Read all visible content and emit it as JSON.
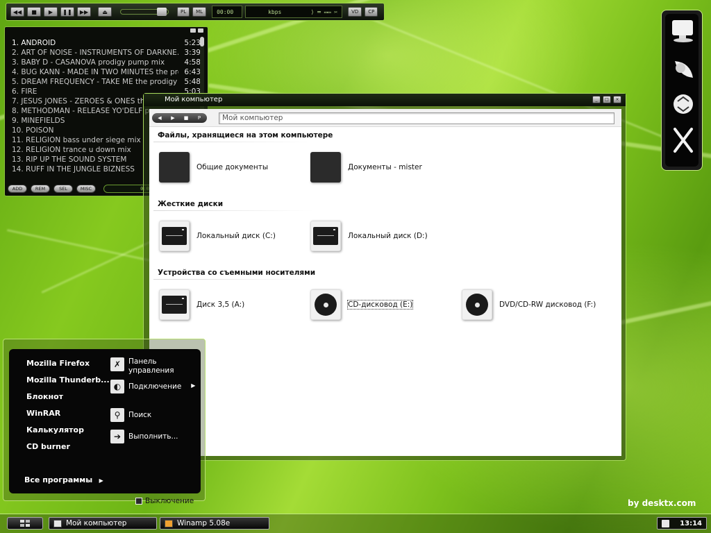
{
  "player": {
    "buttons": [
      "◀◀",
      "■",
      "▶",
      "❚❚",
      "▶▶",
      "⏏"
    ],
    "pl_label": "PL",
    "ml_label": "ML",
    "time": "00:00",
    "kbps": "kbps",
    "vd_label": "VD",
    "cp_label": "CP"
  },
  "playlist": {
    "tracks": [
      {
        "title": "1. ANDROID",
        "duration": "5:23"
      },
      {
        "title": "2. ART OF NOISE - INSTRUMENTS OF DARKNE...",
        "duration": "3:39"
      },
      {
        "title": "3. BABY D - CASANOVA prodigy pump mix",
        "duration": "4:58"
      },
      {
        "title": "4. BUG KANN - MADE IN TWO MINUTES the pro...",
        "duration": "6:43"
      },
      {
        "title": "5. DREAM FREQUENCY - TAKE ME the prodigy ...",
        "duration": "5:48"
      },
      {
        "title": "6. FIRE",
        "duration": "5:03"
      },
      {
        "title": "7. JESUS JONES - ZEROES & ONES the prodig",
        "duration": ""
      },
      {
        "title": "8. METHODMAN - RELEASE YO'DELF pro",
        "duration": ""
      },
      {
        "title": "9. MINEFIELDS",
        "duration": ""
      },
      {
        "title": "10. POISON",
        "duration": ""
      },
      {
        "title": "11. RELIGION bass under siege mix",
        "duration": ""
      },
      {
        "title": "12. RELIGION trance u down mix",
        "duration": ""
      },
      {
        "title": "13. RIP UP THE SOUND SYSTEM",
        "duration": ""
      },
      {
        "title": "14. RUFF IN THE JUNGLE BIZNESS",
        "duration": ""
      }
    ],
    "buttons": [
      "ADD",
      "REM",
      "SEL",
      "MISC"
    ],
    "time_display": "0:00/1:5"
  },
  "explorer": {
    "title": "Мой компьютер",
    "address": "Мой компьютер",
    "sections": [
      {
        "heading": "Файлы, хранящиеся на этом компьютере",
        "items": [
          {
            "label": "Общие документы",
            "icon": "folder"
          },
          {
            "label": "Документы - mister",
            "icon": "folder"
          }
        ]
      },
      {
        "heading": "Жесткие диски",
        "items": [
          {
            "label": "Локальный диск (C:)",
            "icon": "hard-disk"
          },
          {
            "label": "Локальный диск (D:)",
            "icon": "hard-disk"
          }
        ]
      },
      {
        "heading": "Устройства со съемными носителями",
        "items": [
          {
            "label": "Диск 3,5 (A:)",
            "icon": "floppy"
          },
          {
            "label": "CD-дисковод (E:)",
            "icon": "cd"
          },
          {
            "label": "DVD/CD-RW дисковод (F:)",
            "icon": "dvd"
          }
        ]
      }
    ]
  },
  "startmenu": {
    "programs": [
      "Mozilla Firefox",
      "Mozilla Thunderb...",
      "Блокнот",
      "WinRAR",
      "Калькулятор",
      "CD burner"
    ],
    "all_programs": "Все программы",
    "right_items": [
      {
        "label": "Панель управления",
        "icon": "tools"
      },
      {
        "label": "Подключение",
        "icon": "network"
      },
      {
        "label": "Поиск",
        "icon": "search"
      },
      {
        "label": "Выполнить...",
        "icon": "run-arrow"
      }
    ],
    "shutdown": "Выключение"
  },
  "brand": "by desktx.com",
  "taskbar": {
    "tasks": [
      {
        "label": "Мой компьютер",
        "icon": "computer"
      },
      {
        "label": "Winamp 5.08e",
        "icon": "winamp"
      }
    ],
    "clock": "13:14"
  },
  "colors": {
    "accent": "#9bd04a",
    "wallpaper": "#7cc01c",
    "panel": "#070707"
  }
}
